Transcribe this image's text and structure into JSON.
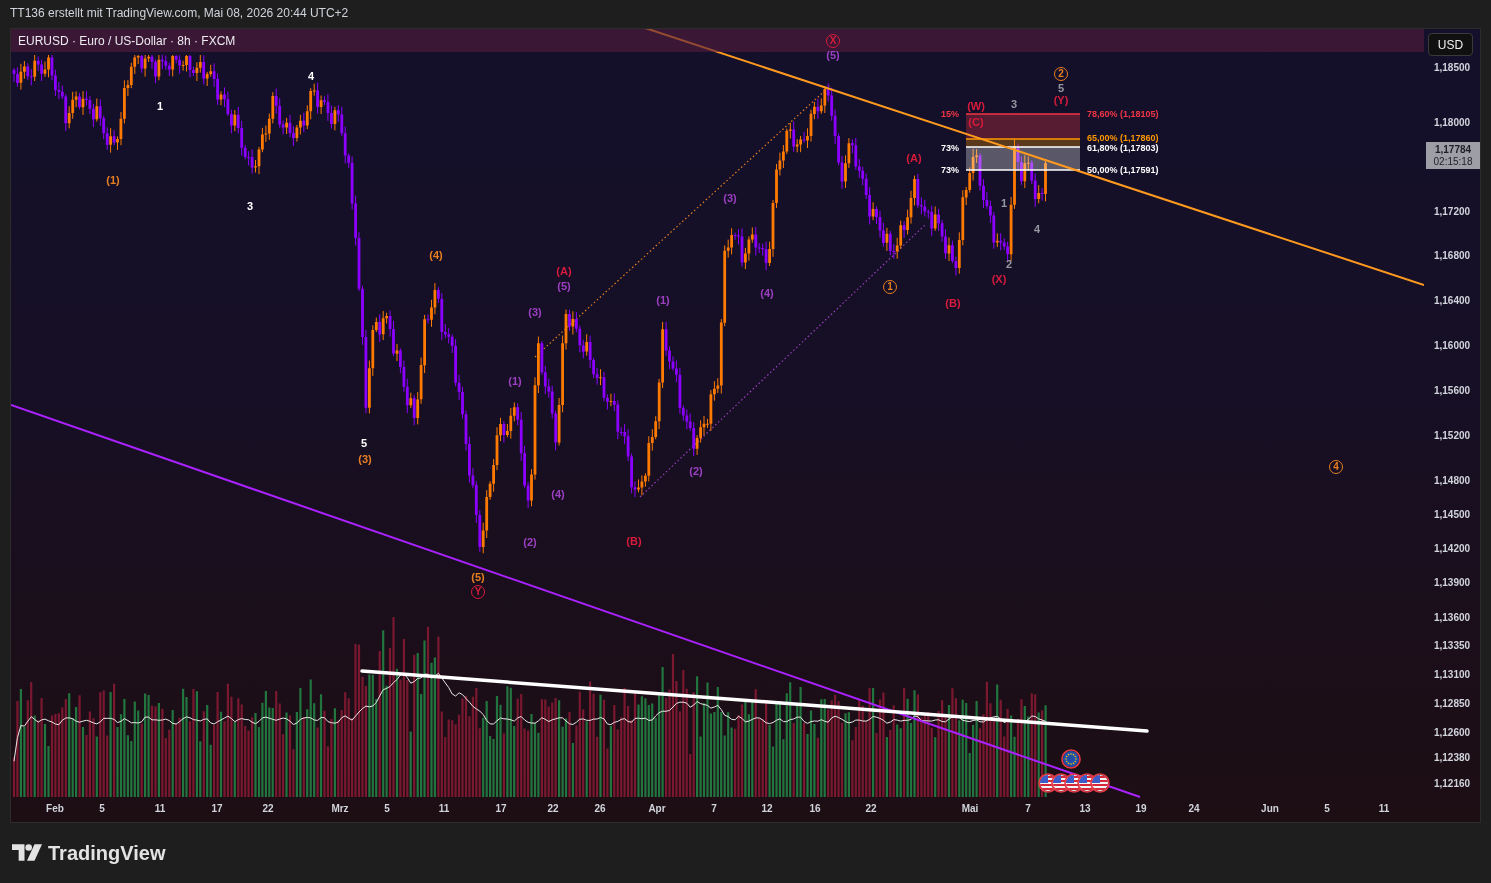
{
  "header": {
    "caption": "TT136 erstellt mit TradingView.com, Mai 08, 2026 20:44 UTC+2"
  },
  "chart": {
    "legend": "EURUSD · Euro / US-Dollar · 8h · FXCM",
    "currency_button": "USD",
    "price_axis": {
      "ticks": [
        "1,18500",
        "1,18000",
        "1,17200",
        "1,16800",
        "1,16400",
        "1,16000",
        "1,15600",
        "1,15200",
        "1,14800",
        "1,14500",
        "1,14200",
        "1,13900",
        "1,13600",
        "1,13350",
        "1,13100",
        "1,12850",
        "1,12600",
        "1,12380",
        "1,12160"
      ]
    },
    "last_price": {
      "price": "1,17784",
      "countdown": "02:15:18"
    },
    "time_axis": {
      "ticks": [
        "Feb",
        "5",
        "11",
        "17",
        "22",
        "Mrz",
        "5",
        "11",
        "17",
        "22",
        "26",
        "Apr",
        "7",
        "12",
        "16",
        "22",
        "Mai",
        "7",
        "13",
        "19",
        "24",
        "Jun",
        "5",
        "11"
      ]
    },
    "fib_levels": [
      {
        "label": "78,60% (1,18105)",
        "side_label": "15%",
        "color": "#f23645"
      },
      {
        "label": "65,00% (1,17860)",
        "color": "#ff9800"
      },
      {
        "label": "61,80% (1,17803)",
        "side_label": "73%",
        "color": "#ffffff"
      },
      {
        "label": "50,00% (1,17591)",
        "side_label": "73%",
        "color": "#ffffff"
      }
    ],
    "wave_labels": [
      {
        "text": "(1)",
        "color": "#e67e22",
        "circled": false
      },
      {
        "text": "1",
        "color": "#ffffff",
        "circled": false
      },
      {
        "text": "3",
        "color": "#ffffff",
        "circled": false
      },
      {
        "text": "4",
        "color": "#ffffff",
        "circled": false
      },
      {
        "text": "5",
        "color": "#ffffff",
        "circled": false
      },
      {
        "text": "(3)",
        "color": "#e67e22",
        "circled": false
      },
      {
        "text": "(4)",
        "color": "#e67e22",
        "circled": false
      },
      {
        "text": "(5)",
        "color": "#e67e22",
        "circled": false
      },
      {
        "text": "Y",
        "color": "#d81b3c",
        "circled": true
      },
      {
        "text": "(1)",
        "color": "#9c3fc0",
        "circled": false
      },
      {
        "text": "(2)",
        "color": "#9c3fc0",
        "circled": false
      },
      {
        "text": "(3)",
        "color": "#9c3fc0",
        "circled": false
      },
      {
        "text": "(4)",
        "color": "#9c3fc0",
        "circled": false
      },
      {
        "text": "(A)",
        "color": "#d81b3c",
        "circled": false
      },
      {
        "text": "(5)",
        "color": "#9c3fc0",
        "circled": false
      },
      {
        "text": "(B)",
        "color": "#d81b3c",
        "circled": false
      },
      {
        "text": "(1)",
        "color": "#9c3fc0",
        "circled": false
      },
      {
        "text": "(2)",
        "color": "#9c3fc0",
        "circled": false
      },
      {
        "text": "(3)",
        "color": "#9c3fc0",
        "circled": false
      },
      {
        "text": "(4)",
        "color": "#9c3fc0",
        "circled": false
      },
      {
        "text": "X",
        "color": "#d81b3c",
        "circled": true
      },
      {
        "text": "(5)",
        "color": "#9c3fc0",
        "circled": false
      },
      {
        "text": "1",
        "color": "#e67e22",
        "circled": true
      },
      {
        "text": "(A)",
        "color": "#d81b3c",
        "circled": false
      },
      {
        "text": "(B)",
        "color": "#d81b3c",
        "circled": false
      },
      {
        "text": "(W)",
        "color": "#d81b3c",
        "circled": false
      },
      {
        "text": "(C)",
        "color": "#d81b3c",
        "circled": false
      },
      {
        "text": "(X)",
        "color": "#d81b3c",
        "circled": false
      },
      {
        "text": "1",
        "color": "#9598a1",
        "circled": false
      },
      {
        "text": "2",
        "color": "#9598a1",
        "circled": false
      },
      {
        "text": "3",
        "color": "#9598a1",
        "circled": false
      },
      {
        "text": "4",
        "color": "#9598a1",
        "circled": false
      },
      {
        "text": "2",
        "color": "#e67e22",
        "circled": true
      },
      {
        "text": "5",
        "color": "#9598a1",
        "circled": false
      },
      {
        "text": "(Y)",
        "color": "#d81b3c",
        "circled": false
      },
      {
        "text": "4",
        "color": "#e67e22",
        "circled": true
      }
    ]
  },
  "footer": {
    "logo_text": "TradingView"
  }
}
